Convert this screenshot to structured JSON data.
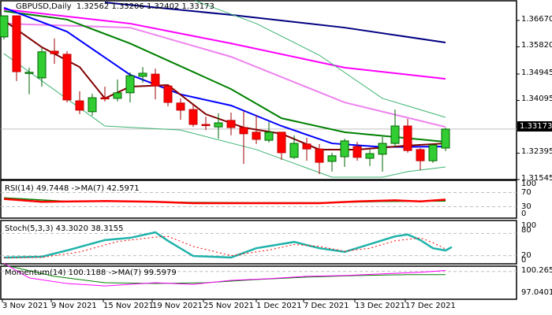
{
  "header": {
    "symbol": "GBPUSD,Daily",
    "open": "1.32562",
    "high": "1.33206",
    "low": "1.32402",
    "close": "1.33173"
  },
  "price_axis": [
    "1.36670",
    "1.35820",
    "1.34945",
    "1.34095",
    "1.32395",
    "1.31545"
  ],
  "price_axis_values": [
    1.3667,
    1.3582,
    1.34945,
    1.34095,
    1.32395,
    1.31545
  ],
  "current_price": "1.33173",
  "current_price_value": 1.33173,
  "colors": {
    "bull": "#32cd32",
    "bear": "#ff0000",
    "navy": "#000080",
    "magenta": "#ff00ff",
    "violet": "#ee82ee",
    "green": "#008000",
    "blue": "#0000ff",
    "brown": "#800000",
    "band": "#3cb371",
    "teal": "#20b2aa"
  },
  "candles": [
    [
      1.3614,
      1.3682,
      1.3606,
      1.3682
    ],
    [
      1.3682,
      1.3682,
      1.3472,
      1.3502
    ],
    [
      1.35,
      1.3515,
      1.3429,
      1.35
    ],
    [
      1.3482,
      1.3578,
      1.3454,
      1.3566
    ],
    [
      1.3568,
      1.3609,
      1.3527,
      1.356
    ],
    [
      1.3558,
      1.3568,
      1.3403,
      1.3411
    ],
    [
      1.3408,
      1.3439,
      1.3365,
      1.3378
    ],
    [
      1.3373,
      1.3431,
      1.336,
      1.3418
    ],
    [
      1.3418,
      1.3454,
      1.3406,
      1.3416
    ],
    [
      1.3416,
      1.3477,
      1.3406,
      1.3434
    ],
    [
      1.3434,
      1.35,
      1.3403,
      1.3489
    ],
    [
      1.3487,
      1.3517,
      1.3467,
      1.3497
    ],
    [
      1.3494,
      1.3512,
      1.3413,
      1.3456
    ],
    [
      1.3456,
      1.3456,
      1.339,
      1.3403
    ],
    [
      1.3401,
      1.3416,
      1.3347,
      1.3378
    ],
    [
      1.338,
      1.3396,
      1.3324,
      1.3332
    ],
    [
      1.3332,
      1.3357,
      1.3314,
      1.333
    ],
    [
      1.3324,
      1.3368,
      1.3286,
      1.3337
    ],
    [
      1.3345,
      1.337,
      1.3297,
      1.3322
    ],
    [
      1.3322,
      1.3375,
      1.3205,
      1.3302
    ],
    [
      1.3307,
      1.3363,
      1.3269,
      1.3284
    ],
    [
      1.3281,
      1.334,
      1.3274,
      1.3307
    ],
    [
      1.3307,
      1.3307,
      1.3218,
      1.3241
    ],
    [
      1.3226,
      1.3297,
      1.3221,
      1.3271
    ],
    [
      1.3269,
      1.3289,
      1.3215,
      1.3253
    ],
    [
      1.3253,
      1.3269,
      1.3172,
      1.321
    ],
    [
      1.3213,
      1.3241,
      1.318,
      1.3231
    ],
    [
      1.3228,
      1.3286,
      1.3195,
      1.3279
    ],
    [
      1.3261,
      1.3276,
      1.3215,
      1.3226
    ],
    [
      1.3223,
      1.3251,
      1.3198,
      1.3238
    ],
    [
      1.3236,
      1.3292,
      1.318,
      1.3271
    ],
    [
      1.3271,
      1.338,
      1.3259,
      1.3327
    ],
    [
      1.3327,
      1.335,
      1.3241,
      1.3248
    ],
    [
      1.3251,
      1.3256,
      1.3185,
      1.3215
    ],
    [
      1.3215,
      1.3266,
      1.3208,
      1.3266
    ],
    [
      1.3256,
      1.3321,
      1.3246,
      1.3317
    ]
  ],
  "lines": [
    {
      "name": "ma-navy",
      "color": "#000080",
      "w": 2,
      "pts": [
        [
          8,
          1.3725
        ],
        [
          18,
          1.3685
        ],
        [
          27,
          1.3644
        ],
        [
          35,
          1.3596
        ]
      ]
    },
    {
      "name": "ma-magenta",
      "color": "#ff00ff",
      "w": 2,
      "pts": [
        [
          0,
          1.3703
        ],
        [
          10,
          1.3657
        ],
        [
          18,
          1.3593
        ],
        [
          27,
          1.3515
        ],
        [
          35,
          1.3479
        ]
      ]
    },
    {
      "name": "ma-violet",
      "color": "#ee82ee",
      "w": 2,
      "pts": [
        [
          0,
          1.3657
        ],
        [
          10,
          1.3644
        ],
        [
          18,
          1.355
        ],
        [
          27,
          1.3403
        ],
        [
          35,
          1.3324
        ]
      ]
    },
    {
      "name": "ma-green",
      "color": "#008000",
      "w": 2,
      "pts": [
        [
          0,
          1.3697
        ],
        [
          5,
          1.367
        ],
        [
          10,
          1.3593
        ],
        [
          18,
          1.3446
        ],
        [
          22,
          1.3352
        ],
        [
          27,
          1.3307
        ],
        [
          35,
          1.3276
        ]
      ]
    },
    {
      "name": "ma-blue",
      "color": "#0000ff",
      "w": 2,
      "pts": [
        [
          0,
          1.3708
        ],
        [
          5,
          1.3631
        ],
        [
          10,
          1.3492
        ],
        [
          14,
          1.3429
        ],
        [
          18,
          1.3393
        ],
        [
          22,
          1.3327
        ],
        [
          26,
          1.3271
        ],
        [
          30,
          1.3259
        ],
        [
          35,
          1.3261
        ]
      ]
    },
    {
      "name": "ma-brown",
      "color": "#800000",
      "w": 2,
      "pts": [
        [
          0,
          1.3667
        ],
        [
          3,
          1.3581
        ],
        [
          6,
          1.3517
        ],
        [
          8,
          1.3416
        ],
        [
          10,
          1.3454
        ],
        [
          13,
          1.3459
        ],
        [
          16,
          1.3365
        ],
        [
          19,
          1.3322
        ],
        [
          22,
          1.3302
        ],
        [
          25,
          1.3251
        ],
        [
          28,
          1.3251
        ],
        [
          32,
          1.3264
        ],
        [
          35,
          1.3271
        ]
      ]
    },
    {
      "name": "band-upper",
      "color": "#3cb371",
      "w": 1,
      "pts": [
        [
          15,
          1.3733
        ],
        [
          20,
          1.3657
        ],
        [
          25,
          1.3555
        ],
        [
          30,
          1.3416
        ],
        [
          35,
          1.3355
        ]
      ]
    },
    {
      "name": "band-lower",
      "color": "#3cb371",
      "w": 1,
      "pts": [
        [
          0,
          1.356
        ],
        [
          8,
          1.3327
        ],
        [
          14,
          1.3314
        ],
        [
          20,
          1.3251
        ],
        [
          26,
          1.3162
        ],
        [
          30,
          1.3162
        ],
        [
          32,
          1.318
        ],
        [
          35,
          1.3195
        ]
      ]
    }
  ],
  "rsi": {
    "label": "RSI(14) 49.7448  ->MA(7) 42.5971",
    "axis": [
      "100",
      "70",
      "30",
      "0"
    ],
    "rsi": [
      [
        0,
        52
      ],
      [
        3,
        44
      ],
      [
        8,
        46
      ],
      [
        12,
        44
      ],
      [
        15,
        40
      ],
      [
        20,
        40
      ],
      [
        25,
        40
      ],
      [
        28,
        45
      ],
      [
        31,
        48
      ],
      [
        33,
        45
      ],
      [
        35,
        50
      ]
    ],
    "ma": [
      [
        0,
        55
      ],
      [
        5,
        45
      ],
      [
        10,
        45
      ],
      [
        15,
        42
      ],
      [
        20,
        41
      ],
      [
        25,
        41
      ],
      [
        30,
        45
      ],
      [
        35,
        46
      ]
    ]
  },
  "stoch": {
    "label": "Stoch(5,3,3) 43.3020 38.3155",
    "axis": [
      "100",
      "80",
      "20",
      "0"
    ],
    "k": [
      [
        0,
        15
      ],
      [
        3,
        17
      ],
      [
        5,
        34
      ],
      [
        8,
        62
      ],
      [
        10,
        68
      ],
      [
        12,
        83
      ],
      [
        13,
        60
      ],
      [
        15,
        19
      ],
      [
        18,
        15
      ],
      [
        20,
        40
      ],
      [
        23,
        57
      ],
      [
        25,
        40
      ],
      [
        27,
        30
      ],
      [
        29,
        51
      ],
      [
        31,
        72
      ],
      [
        32,
        77
      ],
      [
        33,
        62
      ],
      [
        34,
        40
      ],
      [
        35,
        34
      ],
      [
        35.5,
        43
      ]
    ],
    "d": [
      [
        0,
        14
      ],
      [
        3,
        15
      ],
      [
        6,
        30
      ],
      [
        9,
        58
      ],
      [
        12,
        70
      ],
      [
        13,
        72
      ],
      [
        15,
        45
      ],
      [
        18,
        20
      ],
      [
        21,
        35
      ],
      [
        23,
        50
      ],
      [
        25,
        45
      ],
      [
        27,
        32
      ],
      [
        29,
        40
      ],
      [
        31,
        60
      ],
      [
        33,
        68
      ],
      [
        34,
        55
      ],
      [
        35,
        38
      ]
    ]
  },
  "momentum": {
    "label": "Momentum(14) 100.1188  ->MA(7) 99.5979",
    "axis": [
      "100.2654",
      "97.0401"
    ],
    "m": [
      [
        0,
        101
      ],
      [
        2,
        99.2
      ],
      [
        5,
        98.5
      ],
      [
        8,
        98.2
      ],
      [
        12,
        98.6
      ],
      [
        15,
        98.4
      ],
      [
        18,
        98.9
      ],
      [
        21,
        99.1
      ],
      [
        24,
        99.4
      ],
      [
        27,
        99.5
      ],
      [
        30,
        99.7
      ],
      [
        33,
        99.9
      ],
      [
        35,
        100.12
      ]
    ],
    "ma": [
      [
        0,
        100.8
      ],
      [
        4,
        99.4
      ],
      [
        8,
        98.6
      ],
      [
        12,
        98.5
      ],
      [
        16,
        98.6
      ],
      [
        20,
        99.0
      ],
      [
        24,
        99.3
      ],
      [
        28,
        99.5
      ],
      [
        32,
        99.6
      ],
      [
        35,
        99.6
      ]
    ]
  },
  "x_labels": [
    "3 Nov 2021",
    "9 Nov 2021",
    "15 Nov 2021",
    "19 Nov 2021",
    "25 Nov 2021",
    "1 Dec 2021",
    "7 Dec 2021",
    "13 Dec 2021",
    "17 Dec 2021"
  ]
}
